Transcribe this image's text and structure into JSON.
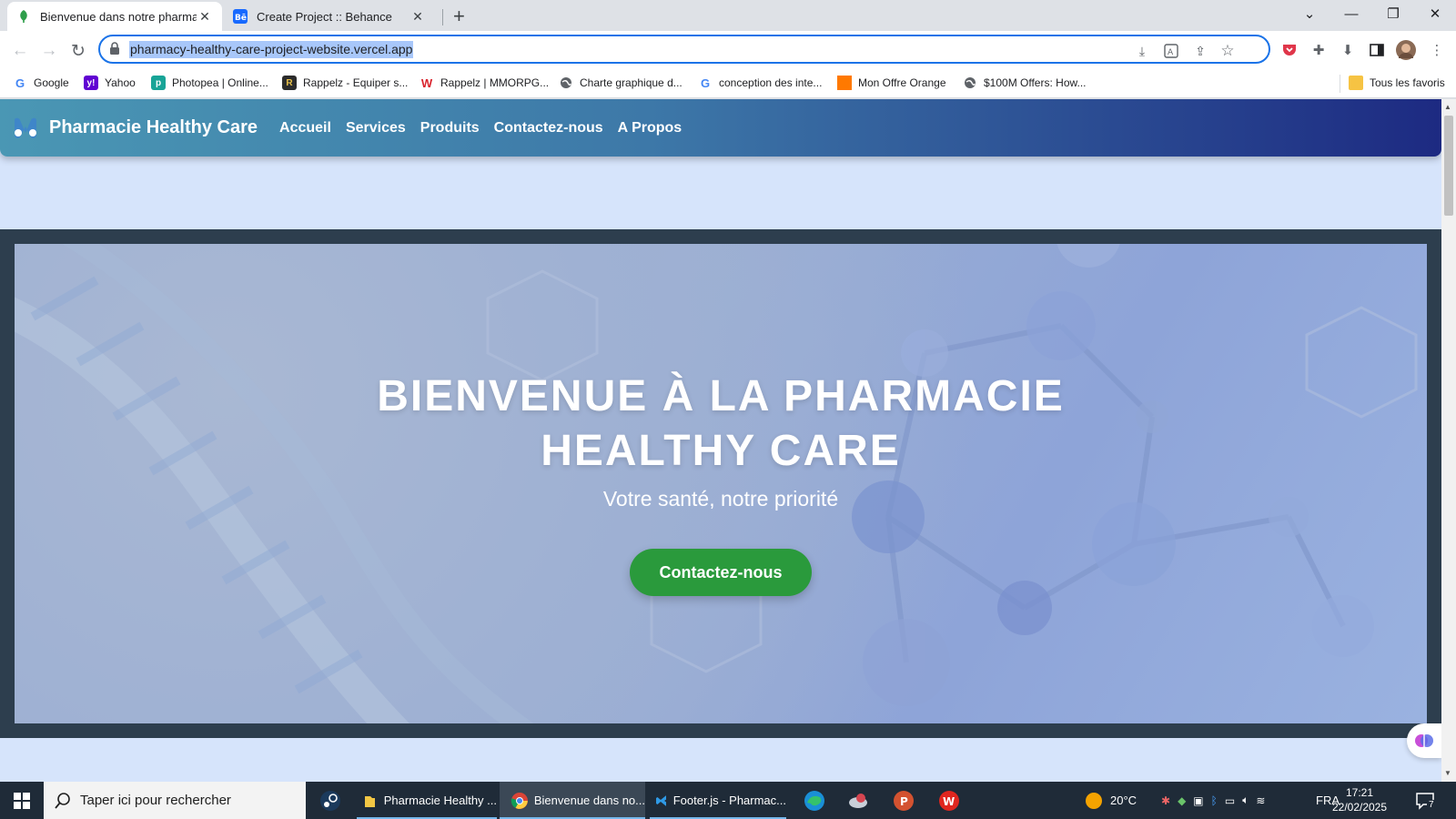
{
  "browser": {
    "tabs": [
      {
        "title": "Bienvenue dans notre pharmacie",
        "active": true
      },
      {
        "title": "Create Project :: Behance",
        "active": false
      }
    ],
    "url": "pharmacy-healthy-care-project-website.vercel.app",
    "bookmarks": [
      {
        "label": "Google",
        "icon": "google-icon",
        "color": "#4285f4"
      },
      {
        "label": "Yahoo",
        "icon": "yahoo-icon",
        "color": "#6001d2"
      },
      {
        "label": "Photopea | Online...",
        "icon": "photopea-icon",
        "color": "#18a497"
      },
      {
        "label": "Rappelz - Equiper s...",
        "icon": "rappelz-icon",
        "color": "#2b2b2b"
      },
      {
        "label": "Rappelz | MMORPG...",
        "icon": "webzen-icon",
        "color": "#d9232d"
      },
      {
        "label": "Charte graphique d...",
        "icon": "globe-icon",
        "color": "#5f6368"
      },
      {
        "label": "conception des inte...",
        "icon": "google-icon",
        "color": "#4285f4"
      },
      {
        "label": "Mon Offre Orange",
        "icon": "orange-icon",
        "color": "#ff7900"
      },
      {
        "label": "$100M Offers: How...",
        "icon": "globe-icon",
        "color": "#5f6368"
      }
    ],
    "all_bookmarks_label": "Tous les favoris"
  },
  "site": {
    "brand": "Pharmacie Healthy Care",
    "nav": [
      "Accueil",
      "Services",
      "Produits",
      "Contactez-nous",
      "A Propos"
    ],
    "hero": {
      "title_line1": "BIENVENUE À LA PHARMACIE",
      "title_line2": "HEALTHY CARE",
      "subtitle": "Votre santé, notre priorité",
      "cta": "Contactez-nous"
    },
    "colors": {
      "accent_green": "#2a9a3c",
      "nav_start": "#4a97b4",
      "nav_end": "#1d2a82"
    }
  },
  "taskbar": {
    "search_placeholder": "Taper ici pour rechercher",
    "apps": [
      {
        "label": "Pharmacie Healthy ...",
        "icon": "folder-icon"
      },
      {
        "label": "Bienvenue dans no...",
        "icon": "chrome-icon"
      },
      {
        "label": "Footer.js - Pharmac...",
        "icon": "vscode-icon"
      }
    ],
    "weather": "20°C",
    "language": "FRA",
    "time": "17:21",
    "date": "22/02/2025",
    "notifications": "7"
  }
}
